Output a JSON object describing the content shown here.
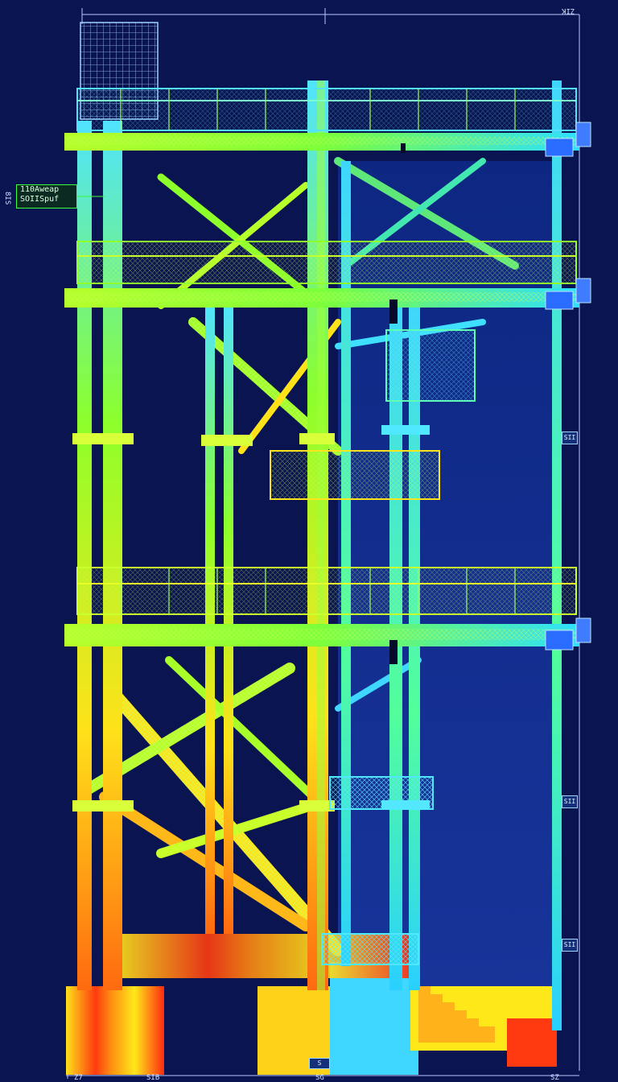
{
  "callout": {
    "line1": "110Aweap",
    "line2": "SOIISpuf"
  },
  "left_marker": "8IS",
  "top_right_marker": "ZIK",
  "elevation_tags": [
    "SII",
    "SII",
    "SII"
  ],
  "bottom_labels": [
    "Z7",
    "SIB",
    "SG",
    "SZ"
  ],
  "bottom_center_box": "S",
  "colors": {
    "background": "#0a1450",
    "cool": "#1fd1ff",
    "mid": "#7dff2a",
    "warm": "#ffe21a",
    "hot": "#ff2a10",
    "dim_lines": "#b7c9ff"
  }
}
